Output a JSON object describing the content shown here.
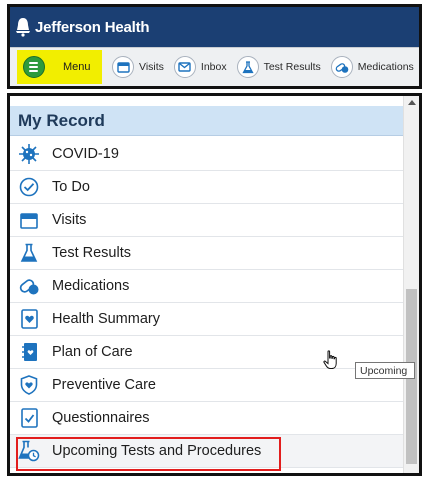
{
  "brand": {
    "name": "Jefferson Health",
    "logo_icon": "jefferson-bell-logo"
  },
  "nav": {
    "menu": {
      "label": "Menu",
      "icon": "hamburger-menu-icon"
    },
    "items": [
      {
        "label": "Visits",
        "icon": "calendar-icon"
      },
      {
        "label": "Inbox",
        "icon": "envelope-icon"
      },
      {
        "label": "Test Results",
        "icon": "flask-icon"
      },
      {
        "label": "Medications",
        "icon": "pill-icon"
      }
    ]
  },
  "record": {
    "title": "My Record",
    "items": [
      {
        "label": "COVID-19",
        "icon": "virus-icon"
      },
      {
        "label": "To Do",
        "icon": "checkmark-circle-icon"
      },
      {
        "label": "Visits",
        "icon": "calendar-icon"
      },
      {
        "label": "Test Results",
        "icon": "flask-icon"
      },
      {
        "label": "Medications",
        "icon": "pill-icon"
      },
      {
        "label": "Health Summary",
        "icon": "heart-document-icon"
      },
      {
        "label": "Plan of Care",
        "icon": "notebook-icon"
      },
      {
        "label": "Preventive Care",
        "icon": "shield-heart-icon"
      },
      {
        "label": "Questionnaires",
        "icon": "checkbox-document-icon"
      },
      {
        "label": "Upcoming Tests and Procedures",
        "icon": "flask-clock-icon"
      }
    ]
  },
  "tooltip": {
    "text": "Upcoming"
  },
  "colors": {
    "brand_bar": "#1b3f73",
    "menu_highlight": "#f2ee00",
    "header_bg": "#cfe3f5",
    "icon_blue": "#1e73be",
    "highlight_border": "#e21d1d"
  }
}
